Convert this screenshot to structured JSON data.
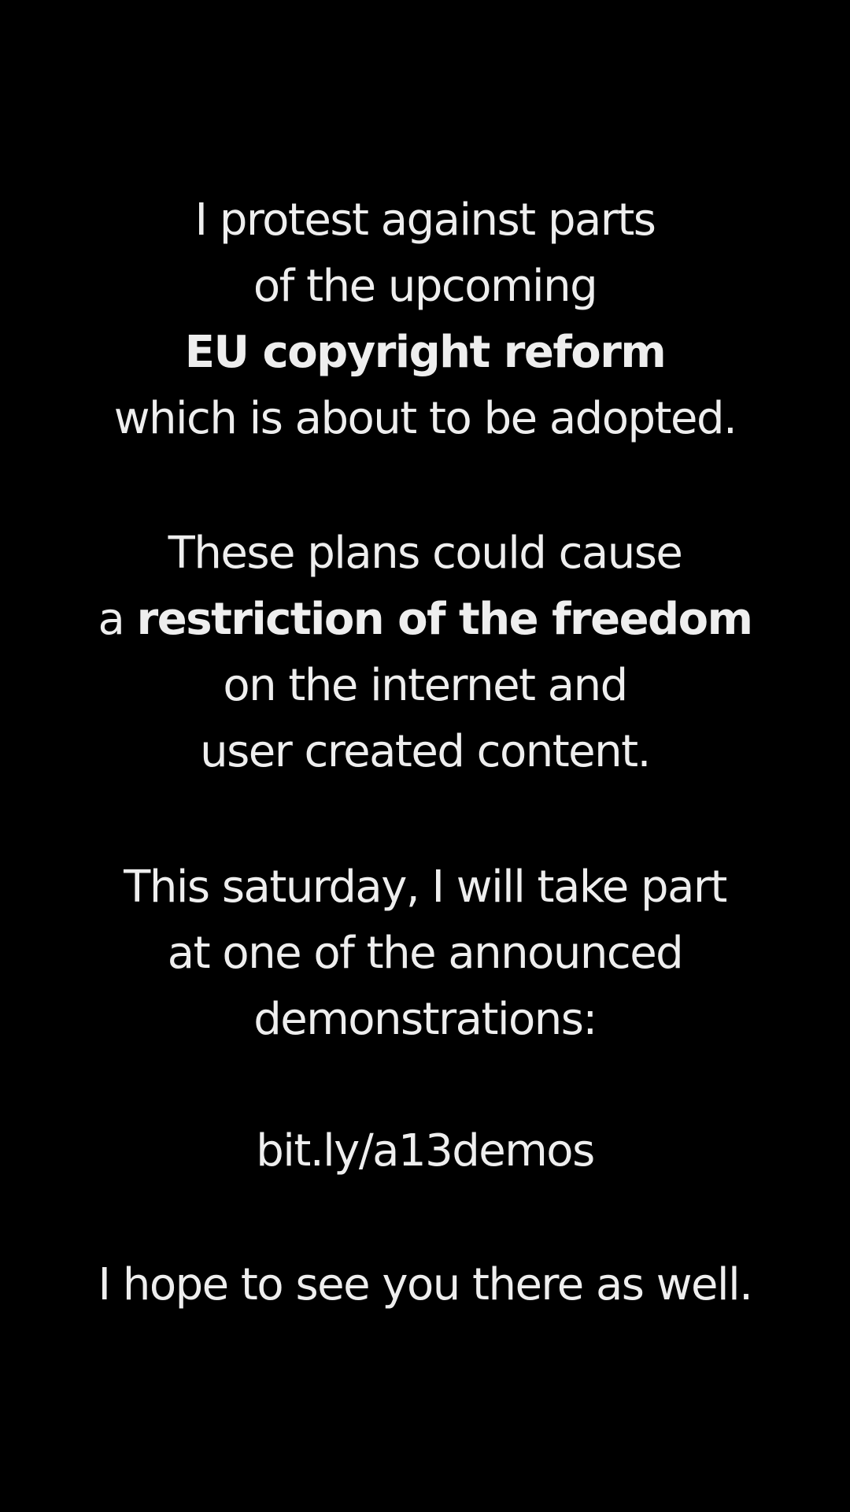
{
  "message": {
    "paragraph1": {
      "line1": "I protest against parts",
      "line2": "of the upcoming",
      "line3": "EU copyright reform",
      "line4": "which is about to be adopted."
    },
    "paragraph2": {
      "line1": "These plans could cause",
      "line2_prefix": "a ",
      "line2_bold": "restriction of the freedom",
      "line3": "on the internet and",
      "line4": "user created content."
    },
    "paragraph3": {
      "line1": "This saturday, I will take part",
      "line2": "at one of the announced",
      "line3": "demonstrations:"
    },
    "link": "bit.ly/a13demos",
    "closing": "I hope to see you there as well."
  },
  "colors": {
    "background": "#000000",
    "text": "#eeeeee"
  }
}
